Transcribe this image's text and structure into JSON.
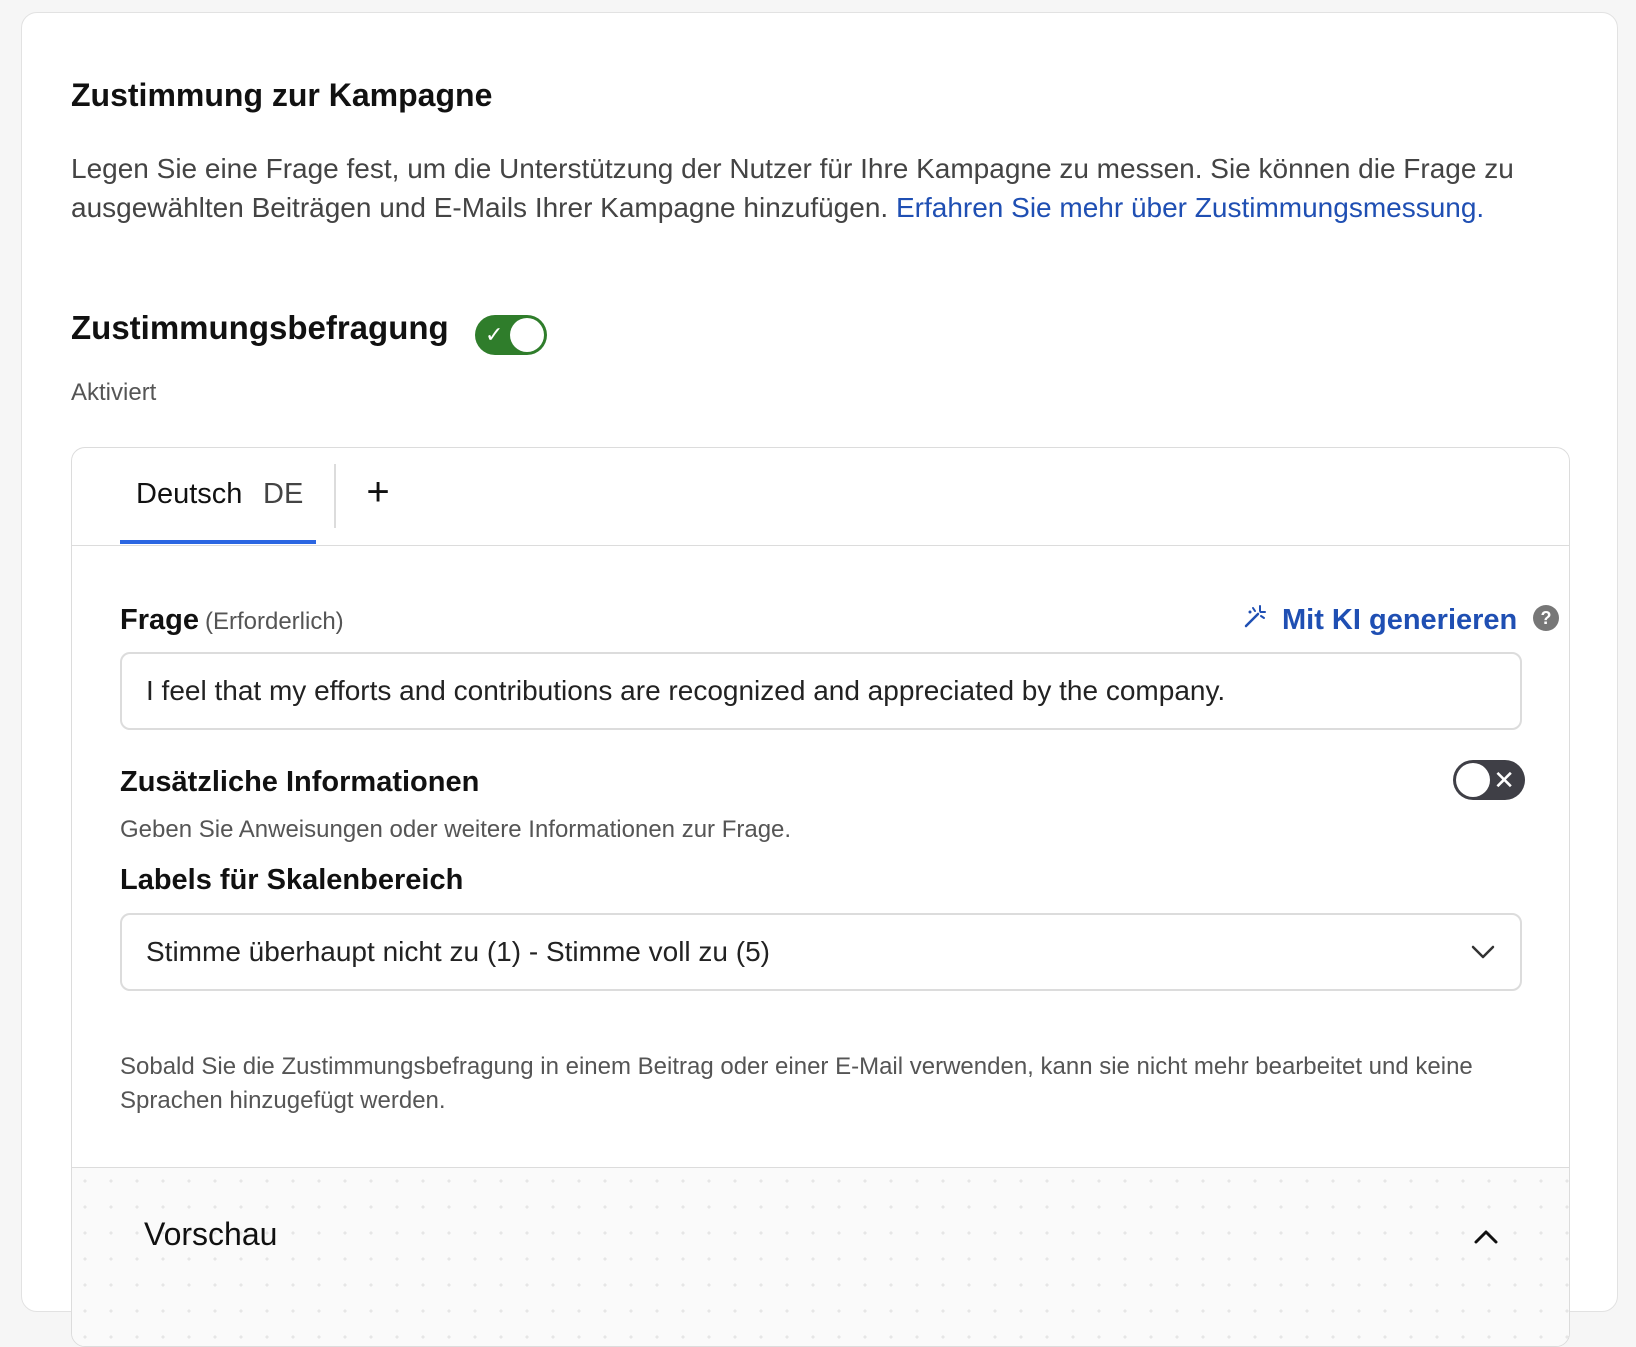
{
  "section": {
    "title": "Zustimmung zur Kampagne",
    "description": "Legen Sie eine Frage fest, um die Unterstützung der Nutzer für Ihre Kampagne zu messen. Sie können die Frage zu ausgewählten Beiträgen und E-Mails Ihrer Kampagne hinzufügen.",
    "learn_more": "Erfahren Sie mehr über Zustimmungsmessung."
  },
  "survey": {
    "title": "Zustimmungsbefragung",
    "toggle_on": true,
    "toggle_check": "✓",
    "status": "Aktiviert"
  },
  "tabs": {
    "language_name": "Deutsch",
    "language_code": "DE",
    "add_symbol": "+"
  },
  "question": {
    "label": "Frage",
    "required": "(Erforderlich)",
    "ai_button": "Mit KI generieren",
    "help": "?",
    "value": "I feel that my efforts and contributions are recognized and appreciated by the company."
  },
  "additional_info": {
    "title": "Zusätzliche Informationen",
    "toggle_on": false,
    "toggle_x": "✕",
    "description": "Geben Sie Anweisungen oder weitere Informationen zur Frage."
  },
  "scale": {
    "title": "Labels für Skalenbereich",
    "selected": "Stimme überhaupt nicht zu (1) - Stimme voll zu (5)"
  },
  "note": "Sobald Sie die Zustimmungsbefragung in einem Beitrag oder einer E-Mail verwenden, kann sie nicht mehr bearbeitet und keine Sprachen hinzugefügt werden.",
  "preview": {
    "title": "Vorschau"
  },
  "colors": {
    "link": "#1f4fb3",
    "toggle_on": "#2f7d2b",
    "toggle_off": "#3f3f46",
    "tab_active": "#2b66e2"
  }
}
